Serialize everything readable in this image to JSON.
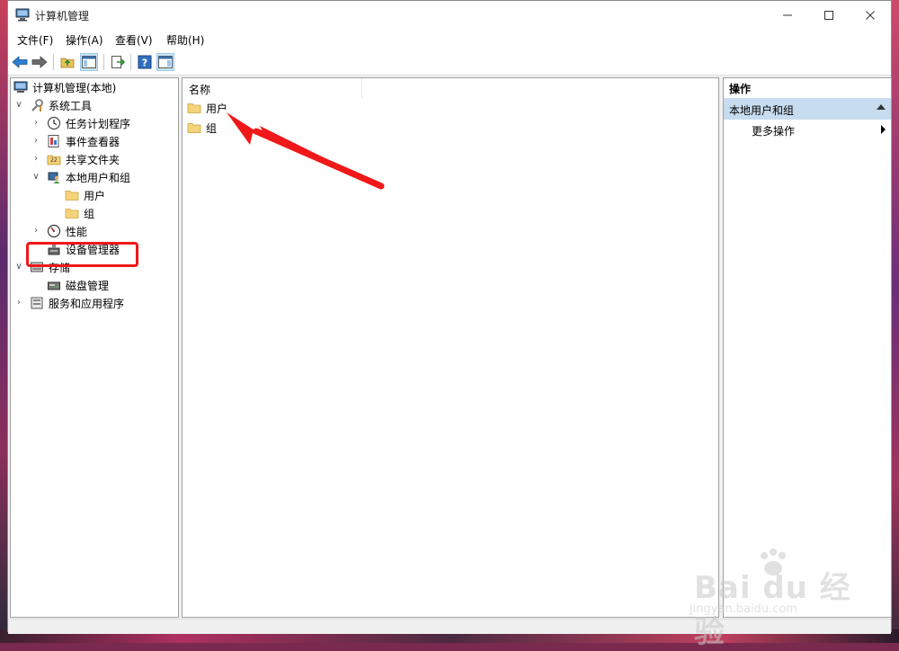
{
  "window": {
    "title": "计算机管理",
    "controls": {
      "minimize": "—",
      "maximize": "☐",
      "close": "✕"
    }
  },
  "menu": [
    "文件(F)",
    "操作(A)",
    "查看(V)",
    "帮助(H)"
  ],
  "toolbar": {
    "buttons": [
      "back-icon",
      "forward-icon",
      "up-folder-icon",
      "show-tree-icon",
      "export-icon",
      "help-icon",
      "show-action-pane-icon"
    ]
  },
  "tree": {
    "root": "计算机管理(本地)",
    "system_tools": "系统工具",
    "task_scheduler": "任务计划程序",
    "event_viewer": "事件查看器",
    "shared_folders": "共享文件夹",
    "local_users_groups": "本地用户和组",
    "users": "用户",
    "groups": "组",
    "performance": "性能",
    "device_manager": "设备管理器",
    "storage": "存储",
    "disk_management": "磁盘管理",
    "services_apps": "服务和应用程序"
  },
  "list": {
    "column_name": "名称",
    "items": [
      "用户",
      "组"
    ]
  },
  "actions": {
    "header": "操作",
    "section": "本地用户和组",
    "more": "更多操作"
  },
  "watermark": {
    "brand": "Bai du 经验",
    "url": "jingyan.baidu.com"
  },
  "colors": {
    "highlight": "#f01818",
    "action_section": "#c7dcef",
    "folder": "#f5d37a"
  }
}
